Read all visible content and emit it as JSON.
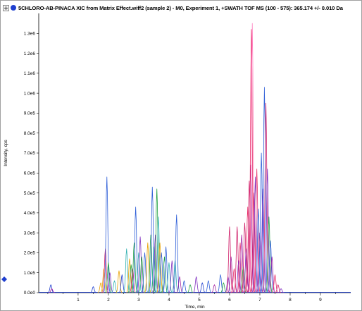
{
  "title": "5CHLORO-AB-PINACA XIC from Matrix Effect.wiff2 (sample 2) - M0, Experiment 1, +SWATH TOF MS (100 - 575): 365.174 +/- 0.010 Da",
  "icons": {
    "expand": "expand-plus-icon",
    "series": "blue-dot-icon",
    "marker": "blue-diamond-marker-icon"
  },
  "chart_data": {
    "type": "line",
    "xlabel": "Time, min",
    "ylabel": "Intensity, cps",
    "xlim": [
      -0.3,
      10.0
    ],
    "ylim": [
      0,
      1400000.0
    ],
    "x_ticks": [
      1,
      2,
      3,
      4,
      5,
      6,
      7,
      8,
      9
    ],
    "x_tick_labels": [
      "1",
      "2",
      "3",
      "4",
      "5",
      "6",
      "7",
      "8",
      "9"
    ],
    "y_ticks": [
      0,
      100000.0,
      200000.0,
      300000.0,
      400000.0,
      500000.0,
      600000.0,
      700000.0,
      800000.0,
      900000.0,
      1000000.0,
      1100000.0,
      1200000.0,
      1300000.0
    ],
    "y_tick_labels": [
      "0.0e0",
      "1.0e5",
      "2.0e5",
      "3.0e5",
      "4.0e5",
      "5.0e5",
      "6.0e5",
      "7.0e5",
      "8.0e5",
      "9.0e5",
      "1.0e6",
      "1.1e6",
      "1.2e6",
      "1.3e6"
    ],
    "grid": false,
    "baseline_y": 2000,
    "peaks": [
      {
        "t": 0.1,
        "h": 40000,
        "c": "#1f3fcf"
      },
      {
        "t": 0.13,
        "h": 20000,
        "c": "#a020a0"
      },
      {
        "t": 1.5,
        "h": 30000,
        "c": "#1f3fcf"
      },
      {
        "t": 1.75,
        "h": 50000,
        "c": "#e8a000"
      },
      {
        "t": 1.85,
        "h": 120000,
        "c": "#e8a000"
      },
      {
        "t": 1.9,
        "h": 220000,
        "c": "#d0206a"
      },
      {
        "t": 1.95,
        "h": 580000,
        "c": "#3060d8"
      },
      {
        "t": 2.0,
        "h": 150000,
        "c": "#20a040"
      },
      {
        "t": 2.05,
        "h": 100000,
        "c": "#8030c0"
      },
      {
        "t": 2.2,
        "h": 60000,
        "c": "#30b0b0"
      },
      {
        "t": 2.35,
        "h": 110000,
        "c": "#e8a000"
      },
      {
        "t": 2.45,
        "h": 90000,
        "c": "#1f3fcf"
      },
      {
        "t": 2.6,
        "h": 220000,
        "c": "#30b0b0"
      },
      {
        "t": 2.7,
        "h": 170000,
        "c": "#e8a000"
      },
      {
        "t": 2.75,
        "h": 140000,
        "c": "#20a040"
      },
      {
        "t": 2.8,
        "h": 120000,
        "c": "#d0206a"
      },
      {
        "t": 2.85,
        "h": 250000,
        "c": "#20a040"
      },
      {
        "t": 2.9,
        "h": 430000,
        "c": "#3060d8"
      },
      {
        "t": 3.0,
        "h": 200000,
        "c": "#30b0b0"
      },
      {
        "t": 3.05,
        "h": 280000,
        "c": "#8030c0"
      },
      {
        "t": 3.1,
        "h": 180000,
        "c": "#20a040"
      },
      {
        "t": 3.2,
        "h": 200000,
        "c": "#3060d8"
      },
      {
        "t": 3.3,
        "h": 250000,
        "c": "#e8a000"
      },
      {
        "t": 3.4,
        "h": 290000,
        "c": "#20a040"
      },
      {
        "t": 3.45,
        "h": 530000,
        "c": "#3060d8"
      },
      {
        "t": 3.5,
        "h": 230000,
        "c": "#30b0b0"
      },
      {
        "t": 3.55,
        "h": 290000,
        "c": "#8030c0"
      },
      {
        "t": 3.6,
        "h": 520000,
        "c": "#20a040"
      },
      {
        "t": 3.65,
        "h": 380000,
        "c": "#30b0b0"
      },
      {
        "t": 3.7,
        "h": 250000,
        "c": "#e8a000"
      },
      {
        "t": 3.75,
        "h": 200000,
        "c": "#3060d8"
      },
      {
        "t": 3.85,
        "h": 180000,
        "c": "#20a040"
      },
      {
        "t": 3.9,
        "h": 230000,
        "c": "#3060d8"
      },
      {
        "t": 4.0,
        "h": 150000,
        "c": "#30b0b0"
      },
      {
        "t": 4.1,
        "h": 160000,
        "c": "#8030c0"
      },
      {
        "t": 4.2,
        "h": 160000,
        "c": "#30b0b0"
      },
      {
        "t": 4.25,
        "h": 390000,
        "c": "#3060d8"
      },
      {
        "t": 4.35,
        "h": 80000,
        "c": "#a020a0"
      },
      {
        "t": 4.5,
        "h": 60000,
        "c": "#3060d8"
      },
      {
        "t": 4.7,
        "h": 40000,
        "c": "#20a040"
      },
      {
        "t": 4.9,
        "h": 80000,
        "c": "#8030c0"
      },
      {
        "t": 5.1,
        "h": 50000,
        "c": "#1f3fcf"
      },
      {
        "t": 5.3,
        "h": 60000,
        "c": "#3060d8"
      },
      {
        "t": 5.5,
        "h": 40000,
        "c": "#a020a0"
      },
      {
        "t": 5.7,
        "h": 90000,
        "c": "#3060d8"
      },
      {
        "t": 5.8,
        "h": 50000,
        "c": "#20a040"
      },
      {
        "t": 5.95,
        "h": 80000,
        "c": "#8030c0"
      },
      {
        "t": 6.0,
        "h": 330000,
        "c": "#d0206a"
      },
      {
        "t": 6.05,
        "h": 180000,
        "c": "#a020a0"
      },
      {
        "t": 6.15,
        "h": 120000,
        "c": "#e8306a"
      },
      {
        "t": 6.25,
        "h": 330000,
        "c": "#d0206a"
      },
      {
        "t": 6.3,
        "h": 160000,
        "c": "#8030c0"
      },
      {
        "t": 6.35,
        "h": 250000,
        "c": "#e8306a"
      },
      {
        "t": 6.4,
        "h": 290000,
        "c": "#a020a0"
      },
      {
        "t": 6.45,
        "h": 130000,
        "c": "#20a040"
      },
      {
        "t": 6.5,
        "h": 350000,
        "c": "#d0206a"
      },
      {
        "t": 6.55,
        "h": 220000,
        "c": "#8030c0"
      },
      {
        "t": 6.6,
        "h": 430000,
        "c": "#e8306a"
      },
      {
        "t": 6.65,
        "h": 560000,
        "c": "#d0206a"
      },
      {
        "t": 6.7,
        "h": 640000,
        "c": "#a020a0"
      },
      {
        "t": 6.72,
        "h": 1320000,
        "c": "#e8306a"
      },
      {
        "t": 6.75,
        "h": 1350000,
        "c": "#ff80c0"
      },
      {
        "t": 6.8,
        "h": 500000,
        "c": "#d0206a"
      },
      {
        "t": 6.85,
        "h": 580000,
        "c": "#8030c0"
      },
      {
        "t": 6.9,
        "h": 620000,
        "c": "#e8306a"
      },
      {
        "t": 6.95,
        "h": 420000,
        "c": "#3060d8"
      },
      {
        "t": 7.0,
        "h": 300000,
        "c": "#a020a0"
      },
      {
        "t": 7.05,
        "h": 700000,
        "c": "#3060d8"
      },
      {
        "t": 7.1,
        "h": 520000,
        "c": "#8030c0"
      },
      {
        "t": 7.15,
        "h": 1030000,
        "c": "#3060d8"
      },
      {
        "t": 7.2,
        "h": 950000,
        "c": "#d0206a"
      },
      {
        "t": 7.25,
        "h": 620000,
        "c": "#8030c0"
      },
      {
        "t": 7.3,
        "h": 380000,
        "c": "#20a040"
      },
      {
        "t": 7.35,
        "h": 260000,
        "c": "#3060d8"
      },
      {
        "t": 7.4,
        "h": 180000,
        "c": "#a020a0"
      },
      {
        "t": 7.5,
        "h": 90000,
        "c": "#e8306a"
      },
      {
        "t": 7.6,
        "h": 40000,
        "c": "#d0206a"
      },
      {
        "t": 7.7,
        "h": 20000,
        "c": "#8030c0"
      }
    ]
  }
}
